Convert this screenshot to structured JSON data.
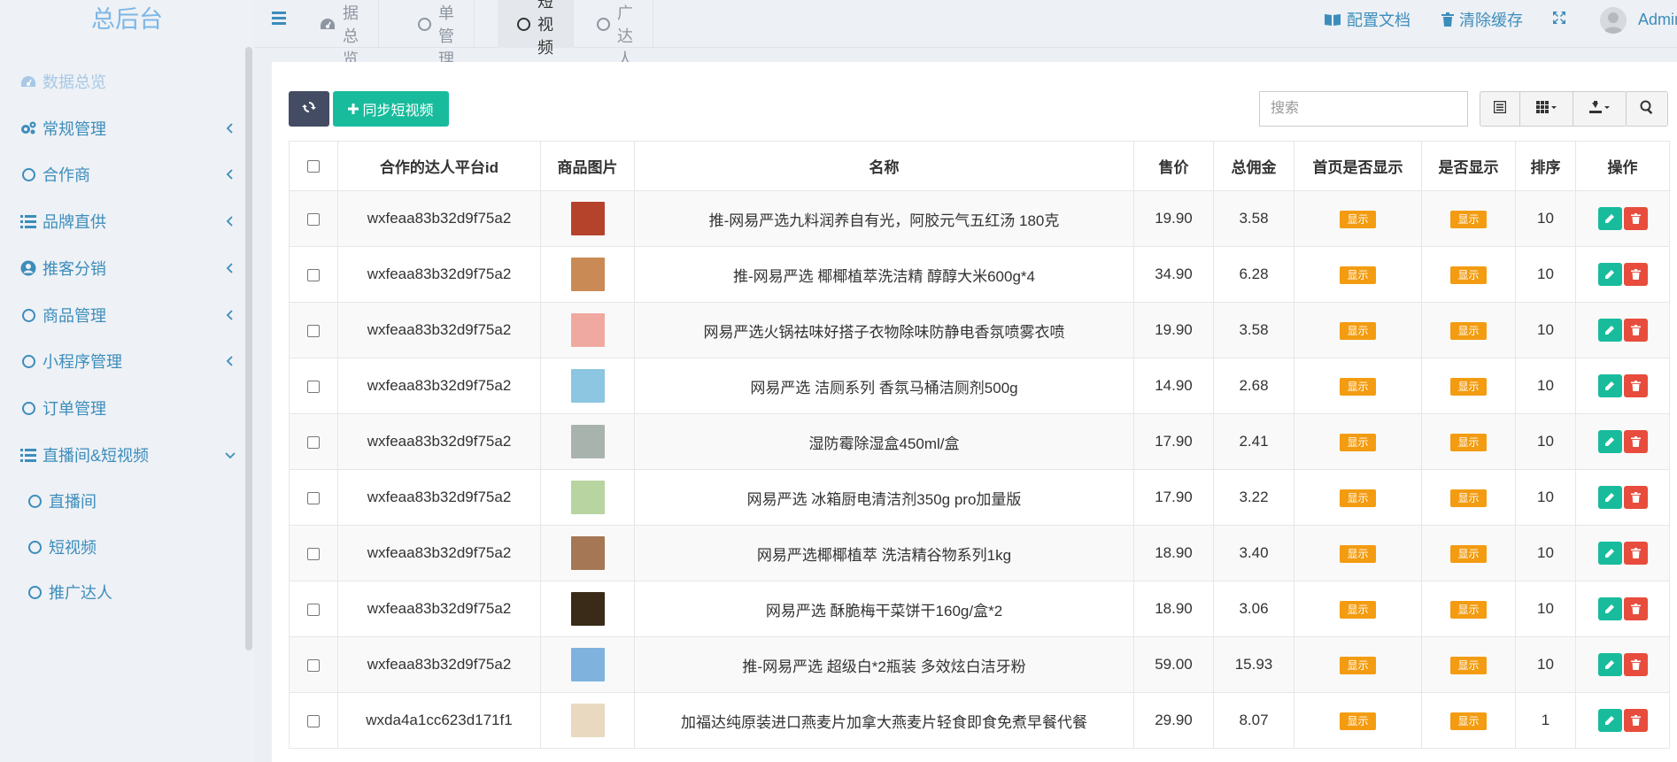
{
  "app": {
    "title": "总后台"
  },
  "colors": {
    "primary": "#3c8dbc",
    "success": "#18bc9c",
    "danger": "#e74c3c",
    "warning": "#f39c12",
    "dark": "#444c63"
  },
  "sidebar": {
    "items": [
      {
        "label": "数据总览",
        "icon": "dashboard-icon",
        "active": true
      },
      {
        "label": "常规管理",
        "icon": "cogs-icon",
        "arrow": "left"
      },
      {
        "label": "合作商",
        "icon": "circle-icon",
        "arrow": "left"
      },
      {
        "label": "品牌直供",
        "icon": "list-icon",
        "arrow": "left"
      },
      {
        "label": "推客分销",
        "icon": "user-circle-icon",
        "arrow": "left"
      },
      {
        "label": "商品管理",
        "icon": "circle-icon",
        "arrow": "left"
      },
      {
        "label": "小程序管理",
        "icon": "circle-icon",
        "arrow": "left"
      },
      {
        "label": "订单管理",
        "icon": "circle-icon"
      },
      {
        "label": "直播间&短视频",
        "icon": "list-icon",
        "arrow": "down"
      }
    ],
    "subitems": [
      {
        "label": "直播间",
        "icon": "circle-icon"
      },
      {
        "label": "短视频",
        "icon": "circle-icon"
      },
      {
        "label": "推广达人",
        "icon": "circle-icon"
      }
    ]
  },
  "topbar": {
    "tabs": [
      {
        "label": "数据总览",
        "icon": "dashboard-icon"
      },
      {
        "label": "订单管理",
        "icon": "circle-icon"
      },
      {
        "label": "短视频",
        "icon": "circle-icon",
        "active": true
      },
      {
        "label": "推广达人",
        "icon": "circle-icon"
      }
    ],
    "config_doc": "配置文档",
    "clear_cache": "清除缓存",
    "user": "Admin"
  },
  "toolbar": {
    "sync_label": "同步短视频",
    "search_placeholder": "搜索"
  },
  "table": {
    "columns": [
      "合作的达人平台id",
      "商品图片",
      "名称",
      "售价",
      "总佣金",
      "首页是否显示",
      "是否显示",
      "排序",
      "操作"
    ],
    "rows": [
      {
        "platform_id": "wxfeaa83b32d9f75a2",
        "name": "推-网易严选九料润养自有光，阿胶元气五红汤 180克",
        "price": "19.90",
        "commission": "3.58",
        "home_show": "显示",
        "show": "显示",
        "sort": "10",
        "thumb_color": "#b5432c"
      },
      {
        "platform_id": "wxfeaa83b32d9f75a2",
        "name": "推-网易严选 椰椰植萃洗洁精 醇醇大米600g*4",
        "price": "34.90",
        "commission": "6.28",
        "home_show": "显示",
        "show": "显示",
        "sort": "10",
        "thumb_color": "#c98a55"
      },
      {
        "platform_id": "wxfeaa83b32d9f75a2",
        "name": "网易严选火锅祛味好搭子衣物除味防静电香氛喷雾衣喷",
        "price": "19.90",
        "commission": "3.58",
        "home_show": "显示",
        "show": "显示",
        "sort": "10",
        "thumb_color": "#f0a9a0"
      },
      {
        "platform_id": "wxfeaa83b32d9f75a2",
        "name": "网易严选 洁厕系列 香氛马桶洁厕剂500g",
        "price": "14.90",
        "commission": "2.68",
        "home_show": "显示",
        "show": "显示",
        "sort": "10",
        "thumb_color": "#8cc6e0"
      },
      {
        "platform_id": "wxfeaa83b32d9f75a2",
        "name": "湿防霉除湿盒450ml/盒",
        "price": "17.90",
        "commission": "2.41",
        "home_show": "显示",
        "show": "显示",
        "sort": "10",
        "thumb_color": "#a9b3ae"
      },
      {
        "platform_id": "wxfeaa83b32d9f75a2",
        "name": "网易严选 冰箱厨电清洁剂350g pro加量版",
        "price": "17.90",
        "commission": "3.22",
        "home_show": "显示",
        "show": "显示",
        "sort": "10",
        "thumb_color": "#b8d4a0"
      },
      {
        "platform_id": "wxfeaa83b32d9f75a2",
        "name": "网易严选椰椰植萃 洗洁精谷物系列1kg",
        "price": "18.90",
        "commission": "3.40",
        "home_show": "显示",
        "show": "显示",
        "sort": "10",
        "thumb_color": "#a57755"
      },
      {
        "platform_id": "wxfeaa83b32d9f75a2",
        "name": "网易严选 酥脆梅干菜饼干160g/盒*2",
        "price": "18.90",
        "commission": "3.06",
        "home_show": "显示",
        "show": "显示",
        "sort": "10",
        "thumb_color": "#3a2a18"
      },
      {
        "platform_id": "wxfeaa83b32d9f75a2",
        "name": "推-网易严选 超级白*2瓶装 多效炫白洁牙粉",
        "price": "59.00",
        "commission": "15.93",
        "home_show": "显示",
        "show": "显示",
        "sort": "10",
        "thumb_color": "#7fb3de"
      },
      {
        "platform_id": "wxda4a1cc623d171f1",
        "name": "加福达纯原装进口燕麦片加拿大燕麦片轻食即食免煮早餐代餐",
        "price": "29.90",
        "commission": "8.07",
        "home_show": "显示",
        "show": "显示",
        "sort": "1",
        "thumb_color": "#e8d9c0"
      }
    ]
  }
}
